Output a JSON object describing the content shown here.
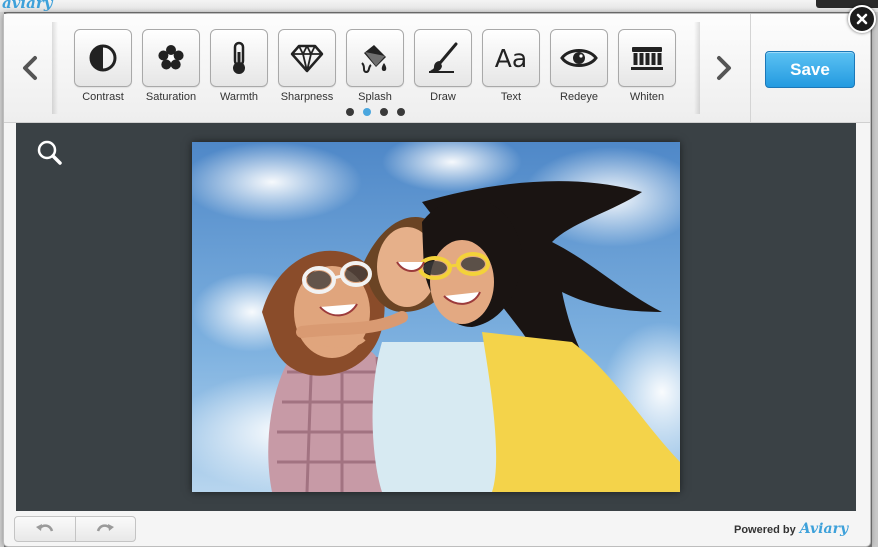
{
  "app": {
    "logo_fragment": "aviary"
  },
  "toolbar": {
    "tools": [
      {
        "label": "Contrast",
        "icon": "contrast-icon"
      },
      {
        "label": "Saturation",
        "icon": "saturation-icon"
      },
      {
        "label": "Warmth",
        "icon": "thermometer-icon"
      },
      {
        "label": "Sharpness",
        "icon": "diamond-icon"
      },
      {
        "label": "Splash",
        "icon": "paint-bucket-icon"
      },
      {
        "label": "Draw",
        "icon": "brush-icon"
      },
      {
        "label": "Text",
        "icon": "text-icon"
      },
      {
        "label": "Redeye",
        "icon": "eye-icon"
      },
      {
        "label": "Whiten",
        "icon": "teeth-icon"
      }
    ],
    "page_count": 4,
    "active_page": 2,
    "save_label": "Save"
  },
  "footer": {
    "powered_by": "Powered by",
    "brand": "Aviary"
  },
  "colors": {
    "accent": "#239ae0",
    "canvas_bg": "#3a4145",
    "active_dot": "#4aa6de"
  }
}
